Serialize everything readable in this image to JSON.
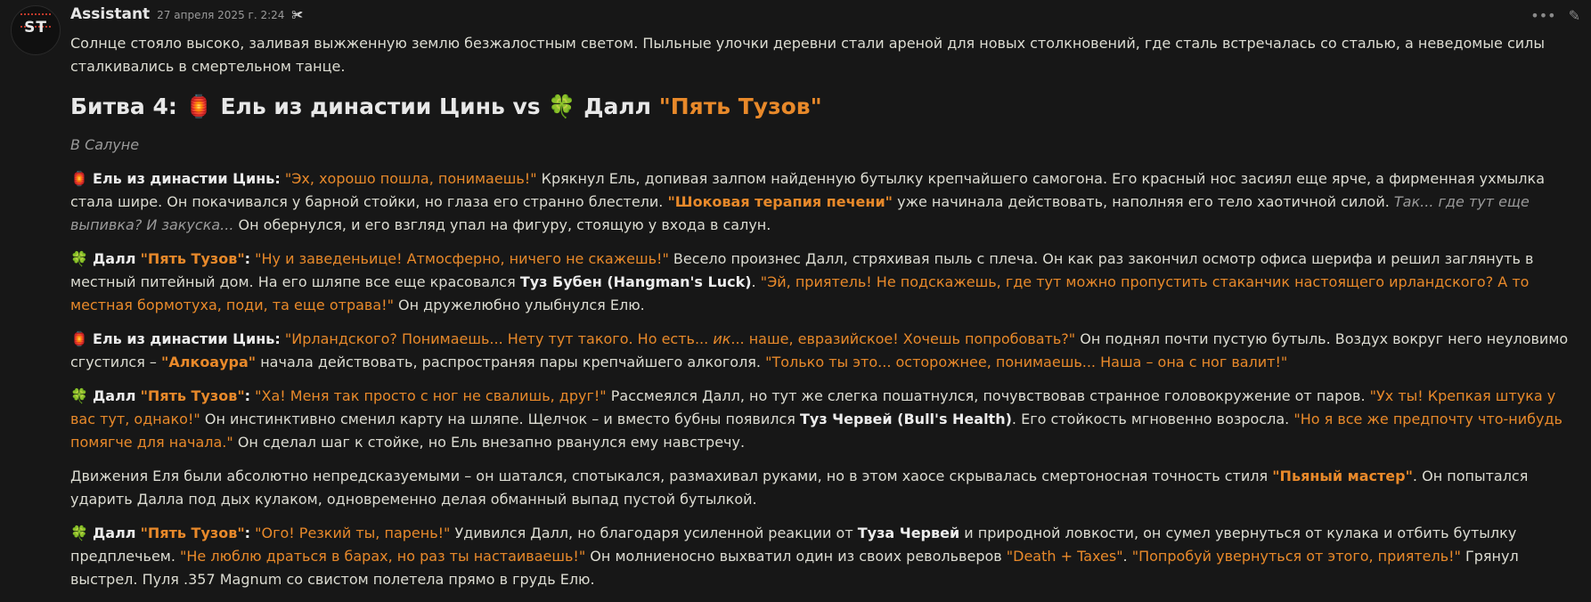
{
  "header": {
    "name": "Assistant",
    "timestamp": "27 апреля 2025 г. 2:24",
    "tool_icon": "puzzle-icon",
    "avatar_text": "ST"
  },
  "intro": "Солнце стояло высоко, заливая выжженную землю безжалостным светом. Пыльные улочки деревни стали ареной для новых столкновений, где сталь встречалась со сталью, а неведомые силы сталкивались в смертельном танце.",
  "heading": {
    "prefix": "Битва 4:",
    "emoji1": "🏮",
    "fighter1": "Ель из династии Цинь vs",
    "emoji2": "🍀",
    "fighter2": "Далл",
    "fighter2_nick": "\"Пять Тузов\""
  },
  "location": "В Салуне",
  "p1": {
    "emoji": "🏮",
    "speaker": "Ель из династии Цинь:",
    "q1": "\"Эх, хорошо пошла, понимаешь!\"",
    "t1": "Крякнул Ель, допивая залпом найденную бутылку крепчайшего самогона. Его красный нос засиял еще ярче, а фирменная ухмылка стала шире. Он покачивался у барной стойки, но глаза его странно блестели.",
    "qb1": "\"Шоковая терапия печени\"",
    "t2": "уже начинала действовать, наполняя его тело хаотичной силой.",
    "em1": "Так... где тут еще выпивка? И закуска...",
    "t3": "Он обернулся, и его взгляд упал на фигуру, стоящую у входа в салун."
  },
  "p2": {
    "emoji": "🍀",
    "speaker": "Далл",
    "nick": "\"Пять Тузов\"",
    "colon": ":",
    "q1": "\"Ну и заведеньице! Атмосферно, ничего не скажешь!\"",
    "t1": "Весело произнес Далл, стряхивая пыль с плеча. Он как раз закончил осмотр офиса шерифа и решил заглянуть в местный питейный дом. На его шляпе все еще красовался",
    "b1": "Туз Бубен (Hangman's Luck)",
    "t2": ".",
    "q2": "\"Эй, приятель! Не подскажешь, где тут можно пропустить стаканчик настоящего ирландского? А то местная бормотуха, поди, та еще отрава!\"",
    "t3": "Он дружелюбно улыбнулся Елю."
  },
  "p3": {
    "emoji": "🏮",
    "speaker": "Ель из династии Цинь:",
    "q1a": "\"Ирландского? Понимаешь... Нету тут такого. Но есть...",
    "q1em": "ик",
    "q1b": "... наше, евразийское! Хочешь попробовать?\"",
    "t1": "Он поднял почти пустую бутыль. Воздух вокруг него неуловимо сгустился –",
    "qb1": "\"Алкоаура\"",
    "t2": "начала действовать, распространяя пары крепчайшего алкоголя.",
    "q2": "\"Только ты это... осторожнее, понимаешь... Наша – она с ног валит!\""
  },
  "p4": {
    "emoji": "🍀",
    "speaker": "Далл",
    "nick": "\"Пять Тузов\"",
    "colon": ":",
    "q1": "\"Ха! Меня так просто с ног не свалишь, друг!\"",
    "t1": "Рассмеялся Далл, но тут же слегка пошатнулся, почувствовав странное головокружение от паров.",
    "q2": "\"Ух ты! Крепкая штука у вас тут, однако!\"",
    "t2": "Он инстинктивно сменил карту на шляпе. Щелчок – и вместо бубны появился",
    "b1": "Туз Червей (Bull's Health)",
    "t3": ". Его стойкость мгновенно возросла.",
    "q3": "\"Но я все же предпочту что-нибудь помягче для начала.\"",
    "t4": "Он сделал шаг к стойке, но Ель внезапно рванулся ему навстречу."
  },
  "p5": {
    "t1": "Движения Еля были абсолютно непредсказуемыми – он шатался, спотыкался, размахивал руками, но в этом хаосе скрывалась смертоносная точность стиля",
    "qb1": "\"Пьяный мастер\"",
    "t2": ". Он попытался ударить Далла под дых кулаком, одновременно делая обманный выпад пустой бутылкой."
  },
  "p6": {
    "emoji": "🍀",
    "speaker": "Далл",
    "nick": "\"Пять Тузов\"",
    "colon": ":",
    "q1": "\"Ого! Резкий ты, парень!\"",
    "t1": "Удивился Далл, но благодаря усиленной реакции от",
    "b1": "Туза Червей",
    "t2": "и природной ловкости, он сумел увернуться от кулака и отбить бутылку предплечьем.",
    "q2": "\"Не люблю драться в барах, но раз ты настаиваешь!\"",
    "t3": "Он молниеносно выхватил один из своих револьверов",
    "q3": "\"Death + Taxes\"",
    "t4": ".",
    "q4": "\"Попробуй увернуться от этого, приятель!\"",
    "t5": "Грянул выстрел. Пуля .357 Magnum со свистом полетела прямо в грудь Елю."
  },
  "actions": {
    "more_icon": "more-icon",
    "edit_icon": "pencil-icon"
  }
}
